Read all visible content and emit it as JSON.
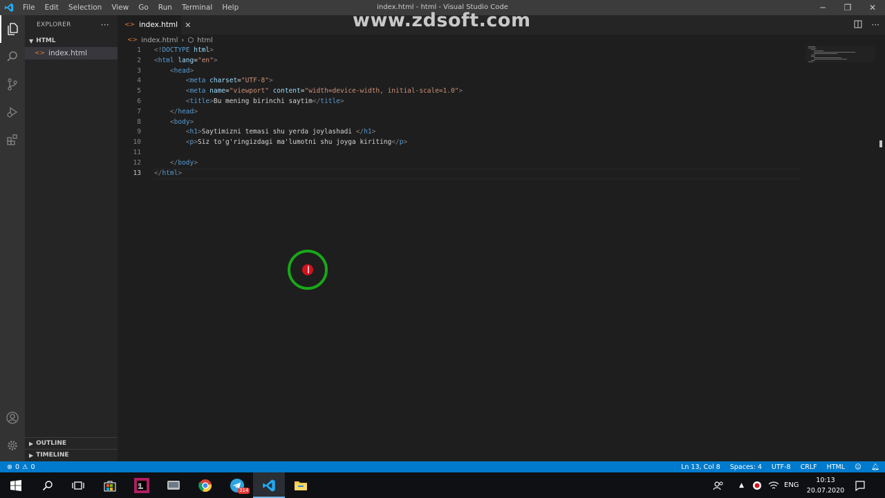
{
  "titlebar": {
    "menu": [
      "File",
      "Edit",
      "Selection",
      "View",
      "Go",
      "Run",
      "Terminal",
      "Help"
    ],
    "window_title": "index.html - html - Visual Studio Code",
    "minimize": "─",
    "maximize": "❐",
    "close": "✕"
  },
  "watermark": "www.zdsoft.com",
  "sidebar": {
    "title": "EXPLORER",
    "more": "···",
    "folder": "HTML",
    "file": "index.html",
    "outline": "OUTLINE",
    "timeline": "TIMELINE"
  },
  "tab": {
    "label": "index.html",
    "close": "✕"
  },
  "breadcrumb": {
    "file": "index.html",
    "sep": "›",
    "symbol": "html"
  },
  "editor": {
    "current_line": 13,
    "lines": [
      {
        "n": "1",
        "tokens": [
          [
            "punc",
            "<!"
          ],
          [
            "tag",
            "DOCTYPE"
          ],
          [
            "text",
            " "
          ],
          [
            "attr",
            "html"
          ],
          [
            "punc",
            ">"
          ]
        ]
      },
      {
        "n": "2",
        "tokens": [
          [
            "punc",
            "<"
          ],
          [
            "tag",
            "html"
          ],
          [
            "text",
            " "
          ],
          [
            "attr",
            "lang"
          ],
          [
            "text",
            "="
          ],
          [
            "str",
            "\"en\""
          ],
          [
            "punc",
            ">"
          ]
        ]
      },
      {
        "n": "3",
        "tokens": [
          [
            "text",
            "    "
          ],
          [
            "punc",
            "<"
          ],
          [
            "tag",
            "head"
          ],
          [
            "punc",
            ">"
          ]
        ]
      },
      {
        "n": "4",
        "tokens": [
          [
            "text",
            "        "
          ],
          [
            "punc",
            "<"
          ],
          [
            "tag",
            "meta"
          ],
          [
            "text",
            " "
          ],
          [
            "attr",
            "charset"
          ],
          [
            "text",
            "="
          ],
          [
            "str",
            "\"UTF-8\""
          ],
          [
            "punc",
            ">"
          ]
        ]
      },
      {
        "n": "5",
        "tokens": [
          [
            "text",
            "        "
          ],
          [
            "punc",
            "<"
          ],
          [
            "tag",
            "meta"
          ],
          [
            "text",
            " "
          ],
          [
            "attr",
            "name"
          ],
          [
            "text",
            "="
          ],
          [
            "str",
            "\"viewport\""
          ],
          [
            "text",
            " "
          ],
          [
            "attr",
            "content"
          ],
          [
            "text",
            "="
          ],
          [
            "str",
            "\"width=device-width, initial-scale=1.0\""
          ],
          [
            "punc",
            ">"
          ]
        ]
      },
      {
        "n": "6",
        "tokens": [
          [
            "text",
            "        "
          ],
          [
            "punc",
            "<"
          ],
          [
            "tag",
            "title"
          ],
          [
            "punc",
            ">"
          ],
          [
            "text",
            "Bu mening birinchi saytim"
          ],
          [
            "punc",
            "</"
          ],
          [
            "tag",
            "title"
          ],
          [
            "punc",
            ">"
          ]
        ]
      },
      {
        "n": "7",
        "tokens": [
          [
            "text",
            "    "
          ],
          [
            "punc",
            "</"
          ],
          [
            "tag",
            "head"
          ],
          [
            "punc",
            ">"
          ]
        ]
      },
      {
        "n": "8",
        "tokens": [
          [
            "text",
            "    "
          ],
          [
            "punc",
            "<"
          ],
          [
            "tag",
            "body"
          ],
          [
            "punc",
            ">"
          ]
        ]
      },
      {
        "n": "9",
        "tokens": [
          [
            "text",
            "        "
          ],
          [
            "punc",
            "<"
          ],
          [
            "tag",
            "h1"
          ],
          [
            "punc",
            ">"
          ],
          [
            "text",
            "Saytimizni temasi shu yerda joylashadi "
          ],
          [
            "punc",
            "</"
          ],
          [
            "tag",
            "h1"
          ],
          [
            "punc",
            ">"
          ]
        ]
      },
      {
        "n": "10",
        "tokens": [
          [
            "text",
            "        "
          ],
          [
            "punc",
            "<"
          ],
          [
            "tag",
            "p"
          ],
          [
            "punc",
            ">"
          ],
          [
            "text",
            "Siz to'g'ringizdagi ma'lumotni shu joyga kiriting"
          ],
          [
            "punc",
            "</"
          ],
          [
            "tag",
            "p"
          ],
          [
            "punc",
            ">"
          ]
        ]
      },
      {
        "n": "11",
        "tokens": []
      },
      {
        "n": "12",
        "tokens": [
          [
            "text",
            "    "
          ],
          [
            "punc",
            "</"
          ],
          [
            "tag",
            "body"
          ],
          [
            "punc",
            ">"
          ]
        ]
      },
      {
        "n": "13",
        "tokens": [
          [
            "punc",
            "</"
          ],
          [
            "tag",
            "html"
          ],
          [
            "punc",
            ">"
          ]
        ]
      }
    ]
  },
  "statusbar": {
    "errors": "0",
    "warnings": "0",
    "position": "Ln 13, Col 8",
    "spaces": "Spaces: 4",
    "encoding": "UTF-8",
    "eol": "CRLF",
    "language": "HTML"
  },
  "taskbar": {
    "apps": [
      "start",
      "search",
      "task-view",
      "store",
      "jetbrains",
      "vmware",
      "chrome",
      "telegram",
      "vscode",
      "file-explorer"
    ],
    "telegram_badge": "314",
    "language": "ENG",
    "time": "10:13",
    "date": "20.07.2020"
  },
  "colors": {
    "accent": "#007acc",
    "tag": "#569cd6",
    "attribute": "#9cdcfe",
    "string": "#ce9178",
    "text": "#d4d4d4",
    "cursor_ring": "#18a818",
    "cursor_dot": "#d0131f"
  }
}
